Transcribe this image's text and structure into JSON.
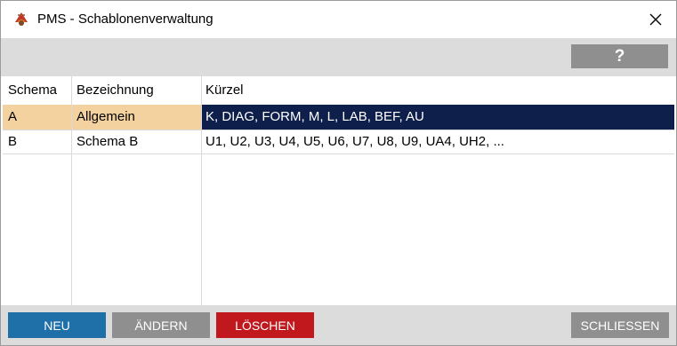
{
  "window": {
    "title": "PMS - Schablonenverwaltung",
    "app_icon": "pms-logo-icon",
    "close_icon": "close-icon"
  },
  "toolbar": {
    "help_label": "?"
  },
  "table": {
    "columns": [
      "Schema",
      "Bezeichnung",
      "Kürzel"
    ],
    "rows": [
      {
        "schema": "A",
        "bezeichnung": "Allgemein",
        "kuerzel": "K, DIAG, FORM, M, L, LAB, BEF, AU",
        "selected": true
      },
      {
        "schema": "B",
        "bezeichnung": "Schema B",
        "kuerzel": "U1, U2, U3, U4, U5, U6, U7, U8, U9, UA4, UH2, ...",
        "selected": false
      }
    ]
  },
  "buttons": {
    "neu": "NEU",
    "aendern": "ÄNDERN",
    "loeschen": "LÖSCHEN",
    "schliessen": "SCHLIESSEN"
  },
  "colors": {
    "neu": "#1f6fa8",
    "aendern": "#8f8f8f",
    "loeschen": "#c0181d",
    "schliessen": "#8f8f8f",
    "selection": "#0d1f4a",
    "selection_highlight": "#f4d2a0"
  }
}
